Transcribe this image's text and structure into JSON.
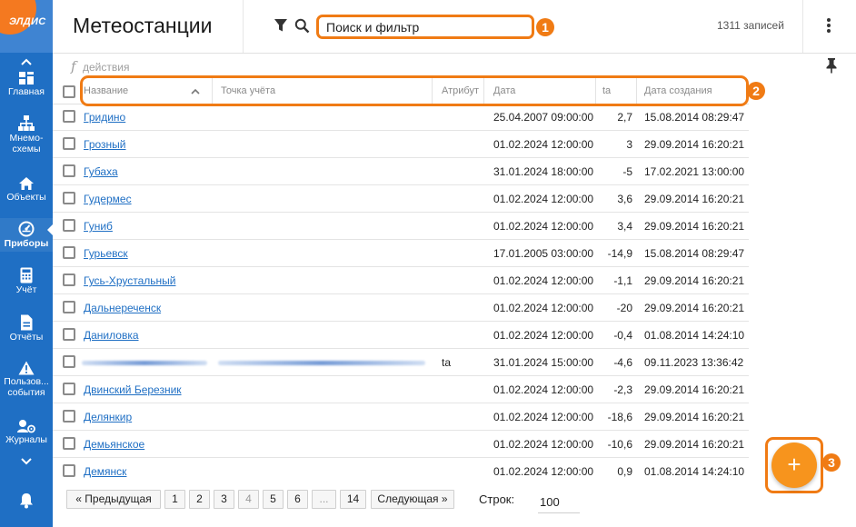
{
  "app": {
    "logo_text": "ЭЛДИС"
  },
  "sidebar": {
    "items": [
      {
        "label": "Главная",
        "icon": "dashboard-icon"
      },
      {
        "label": "Мнемо-",
        "label2": "схемы",
        "icon": "hierarchy-icon"
      },
      {
        "label": "Объекты",
        "icon": "home-icon"
      },
      {
        "label": "Приборы",
        "icon": "gauge-icon"
      },
      {
        "label": "Учёт",
        "icon": "calculator-icon"
      },
      {
        "label": "Отчёты",
        "icon": "document-icon"
      },
      {
        "label": "Пользов...",
        "label2": "события",
        "icon": "warning-icon"
      },
      {
        "label": "Журналы",
        "icon": "settings-list-icon"
      }
    ],
    "active_index": 3,
    "colors": {
      "background": "#1f6fc4",
      "logo_accent": "#f47920"
    }
  },
  "header": {
    "title": "Метеостанции",
    "search_value": "Поиск и фильтр",
    "records_count": "1311 записей"
  },
  "actions_bar": {
    "fx_symbol": "f",
    "label": "действия"
  },
  "table": {
    "columns": [
      "Название",
      "Точка учёта",
      "Атрибут",
      "Дата",
      "ta",
      "Дата создания"
    ],
    "rows": [
      {
        "name": "Гридино",
        "date": "25.04.2007 09:00:00",
        "ta": "2,7",
        "created": "15.08.2014 08:29:47"
      },
      {
        "name": "Грозный",
        "date": "01.02.2024 12:00:00",
        "ta": "3",
        "created": "29.09.2014 16:20:21"
      },
      {
        "name": "Губаха",
        "date": "31.01.2024 18:00:00",
        "ta": "-5",
        "created": "17.02.2021 13:00:00"
      },
      {
        "name": "Гудермес",
        "date": "01.02.2024 12:00:00",
        "ta": "3,6",
        "created": "29.09.2014 16:20:21"
      },
      {
        "name": "Гуниб",
        "date": "01.02.2024 12:00:00",
        "ta": "3,4",
        "created": "29.09.2014 16:20:21"
      },
      {
        "name": "Гурьевск",
        "date": "17.01.2005 03:00:00",
        "ta": "-14,9",
        "created": "15.08.2014 08:29:47"
      },
      {
        "name": "Гусь-Хрустальный",
        "date": "01.02.2024 12:00:00",
        "ta": "-1,1",
        "created": "29.09.2014 16:20:21"
      },
      {
        "name": "Дальнереченск",
        "date": "01.02.2024 12:00:00",
        "ta": "-20",
        "created": "29.09.2014 16:20:21"
      },
      {
        "name": "Даниловка",
        "date": "01.02.2024 12:00:00",
        "ta": "-0,4",
        "created": "01.08.2014 14:24:10"
      },
      {
        "name": "",
        "attr": "ta",
        "date": "31.01.2024 15:00:00",
        "ta": "-4,6",
        "created": "09.11.2023 13:36:42",
        "redacted": true
      },
      {
        "name": "Двинский Березник",
        "date": "01.02.2024 12:00:00",
        "ta": "-2,3",
        "created": "29.09.2014 16:20:21"
      },
      {
        "name": "Делянкир",
        "date": "01.02.2024 12:00:00",
        "ta": "-18,6",
        "created": "29.09.2014 16:20:21"
      },
      {
        "name": "Демьянское",
        "date": "01.02.2024 12:00:00",
        "ta": "-10,6",
        "created": "29.09.2014 16:20:21"
      },
      {
        "name": "Демянск",
        "date": "01.02.2024 12:00:00",
        "ta": "0,9",
        "created": "01.08.2014 14:24:10"
      }
    ]
  },
  "pagination": {
    "prev_label": "« Предыдущая",
    "pages": [
      "1",
      "2",
      "3",
      "4",
      "5",
      "6",
      "...",
      "14"
    ],
    "current_page": "4",
    "next_label": "Следующая »",
    "rows_label": "Строк:",
    "rows_per_page": "100"
  },
  "fab": {
    "label": "+"
  },
  "callouts": [
    "1",
    "2",
    "3"
  ],
  "accent_color": "#f07b14"
}
